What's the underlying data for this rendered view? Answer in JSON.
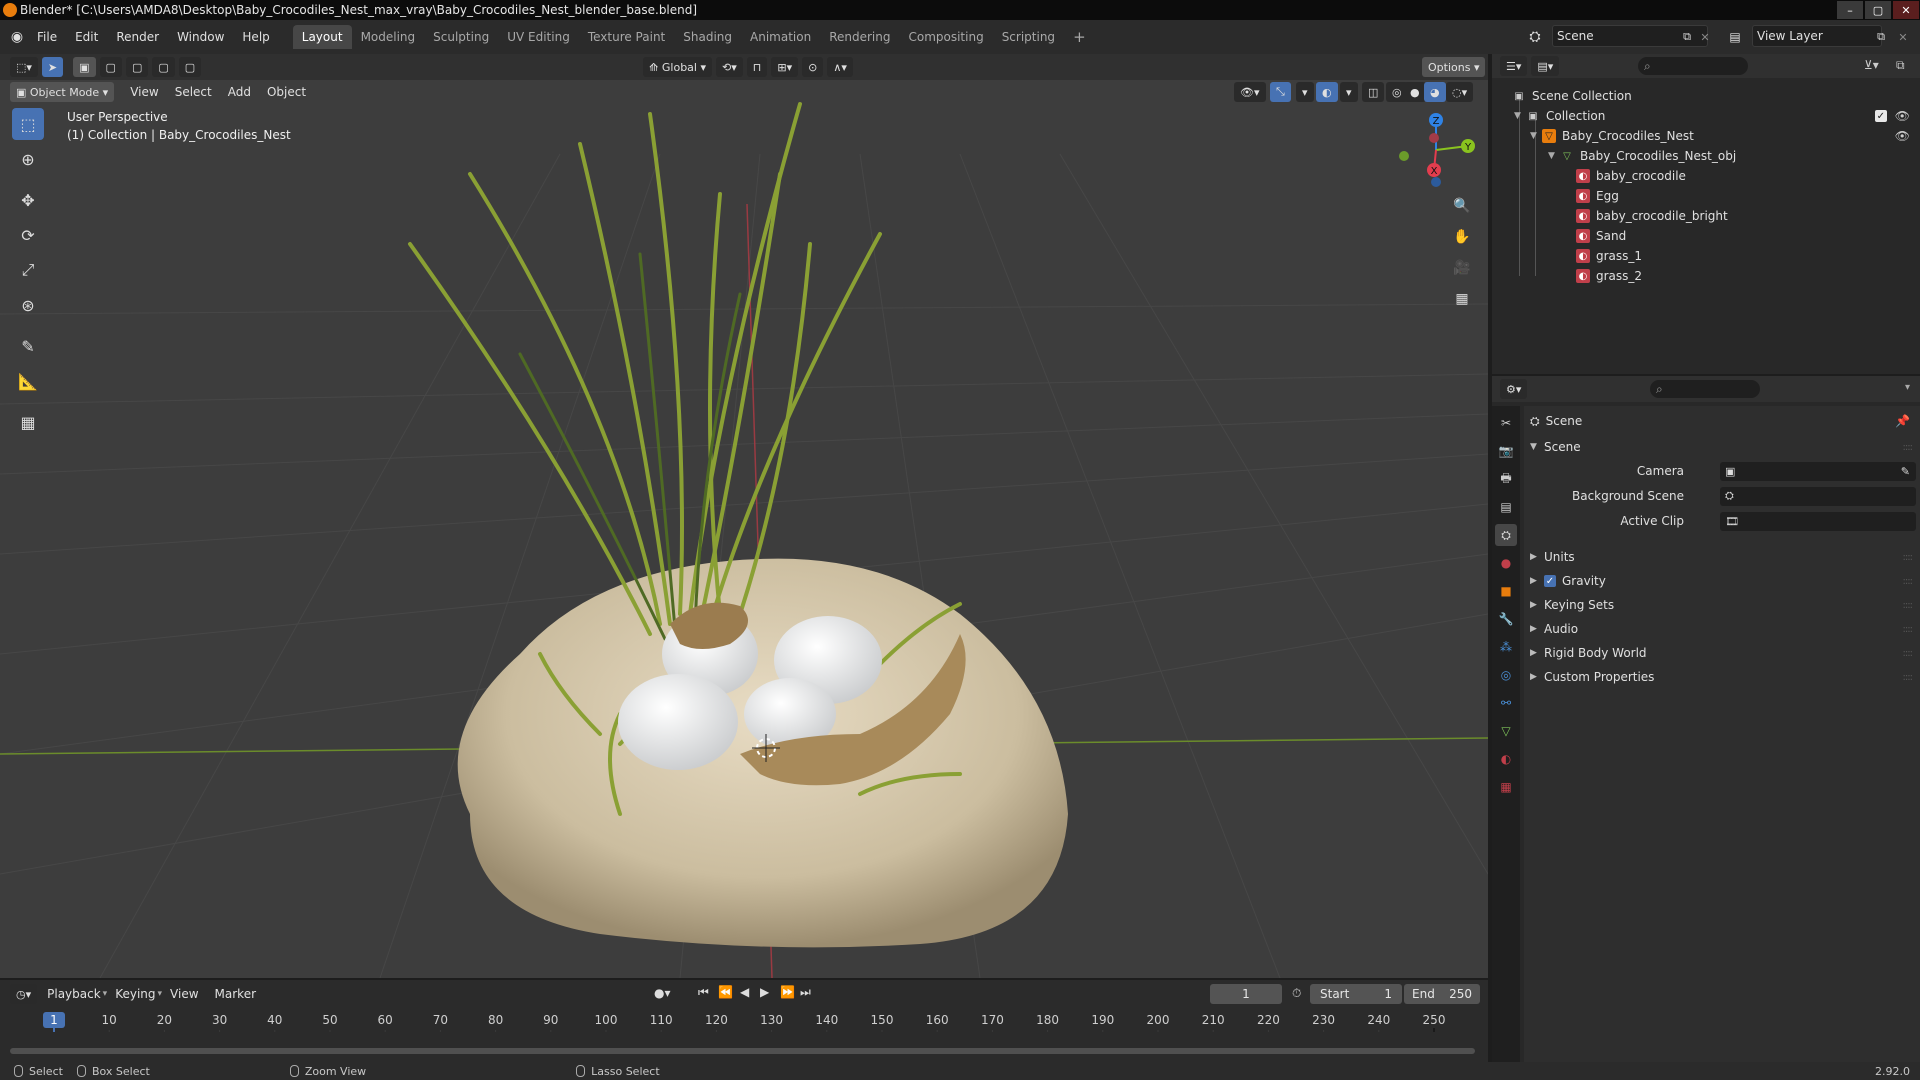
{
  "window": {
    "title": "Blender* [C:\\Users\\AMDA8\\Desktop\\Baby_Crocodiles_Nest_max_vray\\Baby_Crocodiles_Nest_blender_base.blend]",
    "controls": {
      "minimize": "–",
      "maximize": "▢",
      "close": "✕"
    }
  },
  "menu": [
    "File",
    "Edit",
    "Render",
    "Window",
    "Help"
  ],
  "workspaces": [
    {
      "label": "Layout",
      "active": true
    },
    {
      "label": "Modeling"
    },
    {
      "label": "Sculpting"
    },
    {
      "label": "UV Editing"
    },
    {
      "label": "Texture Paint"
    },
    {
      "label": "Shading"
    },
    {
      "label": "Animation"
    },
    {
      "label": "Rendering"
    },
    {
      "label": "Compositing"
    },
    {
      "label": "Scripting"
    }
  ],
  "add_workspace": "+",
  "scene_selector": {
    "value": "Scene"
  },
  "view_layer_selector": {
    "value": "View Layer"
  },
  "viewport": {
    "transform_orientation": "Global",
    "options_label": "Options",
    "mode": "Object Mode",
    "header_menu": [
      "View",
      "Select",
      "Add",
      "Object"
    ],
    "info_line1": "User Perspective",
    "info_line2": "(1) Collection | Baby_Crocodiles_Nest",
    "gizmo": {
      "x": "X",
      "y": "Y",
      "z": "Z"
    }
  },
  "timeline": {
    "menus": [
      "Playback",
      "Keying",
      "View",
      "Marker"
    ],
    "current_frame": "1",
    "start_label": "Start",
    "start": "1",
    "end_label": "End",
    "end": "250",
    "ruler_labels": [
      "1",
      "10",
      "20",
      "30",
      "40",
      "50",
      "60",
      "70",
      "80",
      "90",
      "100",
      "110",
      "120",
      "130",
      "140",
      "150",
      "160",
      "170",
      "180",
      "190",
      "200",
      "210",
      "220",
      "230",
      "240",
      "250"
    ]
  },
  "statusbar": {
    "select": "Select",
    "box_select": "Box Select",
    "zoom_view": "Zoom View",
    "lasso_select": "Lasso Select",
    "version": "2.92.0"
  },
  "outliner": {
    "rows": [
      {
        "label": "Scene Collection"
      },
      {
        "label": "Collection"
      },
      {
        "label": "Baby_Crocodiles_Nest"
      },
      {
        "label": "Baby_Crocodiles_Nest_obj"
      },
      {
        "label": "baby_crocodile"
      },
      {
        "label": "Egg"
      },
      {
        "label": "baby_crocodile_bright"
      },
      {
        "label": "Sand"
      },
      {
        "label": "grass_1"
      },
      {
        "label": "grass_2"
      }
    ]
  },
  "properties": {
    "context_title": "Scene",
    "section": "Scene",
    "fields": [
      {
        "label": "Camera"
      },
      {
        "label": "Background Scene"
      },
      {
        "label": "Active Clip"
      }
    ],
    "panels": [
      "Units",
      "Gravity",
      "Keying Sets",
      "Audio",
      "Rigid Body World",
      "Custom Properties"
    ]
  },
  "colors": {
    "accent": "#4772b3",
    "axis_x": "#e33d4e",
    "axis_y": "#8ac31f",
    "axis_z": "#2f83e6",
    "orange_logo": "#e87d0d",
    "material": "#c13f4a"
  }
}
